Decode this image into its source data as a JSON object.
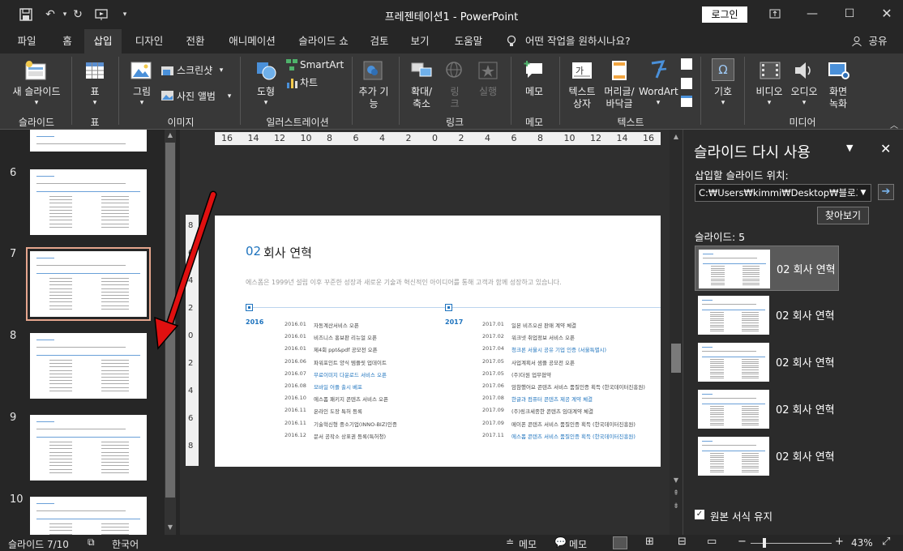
{
  "window": {
    "title": "프레젠테이션1 - PowerPoint",
    "login_label": "로그인",
    "qat_icons": [
      "save-icon",
      "undo-icon",
      "redo-icon",
      "present-icon",
      "customize-icon"
    ]
  },
  "tabs": [
    "파일",
    "홈",
    "삽입",
    "디자인",
    "전환",
    "애니메이션",
    "슬라이드 쇼",
    "검토",
    "보기",
    "도움말"
  ],
  "tell_me": "어떤 작업을 원하시나요?",
  "share": "공유",
  "ribbon": {
    "groups": {
      "slides": "슬라이드",
      "tables": "표",
      "images": "이미지",
      "illustrations": "일러스트레이션",
      "links": "링크",
      "comments": "메모",
      "text": "텍스트",
      "media": "미디어"
    },
    "buttons": {
      "new_slide": "새 슬라이드",
      "table": "표",
      "picture": "그림",
      "screenshot": "스크린샷",
      "photo_album": "사진 앨범",
      "shapes": "도형",
      "smartart": "SmartArt",
      "chart": "차트",
      "addins_1": "추가 기",
      "addins_2": "능",
      "link_1": "확대/",
      "link_2": "축소",
      "hyperlink_1": "링",
      "hyperlink_2": "크",
      "action": "실행",
      "comment": "메모",
      "textbox_1": "텍스트",
      "textbox_2": "상자",
      "header_1": "머리글/",
      "header_2": "바닥글",
      "wordart": "WordArt",
      "symbols": "기호",
      "video": "비디오",
      "audio": "오디오",
      "screenrec_1": "화면",
      "screenrec_2": "녹화"
    }
  },
  "left_pane": {
    "numbers": [
      "6",
      "7",
      "8",
      "9",
      "10"
    ],
    "selected": "7"
  },
  "ruler": {
    "h_ticks": [
      "16",
      "14",
      "12",
      "10",
      "8",
      "6",
      "4",
      "2",
      "0",
      "2",
      "4",
      "6",
      "8",
      "10",
      "12",
      "14",
      "16"
    ],
    "v_ticks": [
      "8",
      "6",
      "4",
      "2",
      "0",
      "2",
      "4",
      "6",
      "8"
    ]
  },
  "slide": {
    "num": "02",
    "title": "회사 연혁",
    "subtitle": "에스폼은 1999년 설립 이후 꾸준한 성장과 새로운 기술과 혁신적인 아이디어를 통해 고객과 함께 성장하고 있습니다.",
    "year_left": "2016",
    "year_right": "2017",
    "left_items": [
      {
        "date": "2016.01",
        "text": "자동계산서비스 오픈",
        "hl": false
      },
      {
        "date": "2016.01",
        "text": "비즈니스 홍보판 리뉴얼 오픈",
        "hl": false
      },
      {
        "date": "2016.01",
        "text": "제4회 ppt&pdf 공모전 오픈",
        "hl": false
      },
      {
        "date": "2016.06",
        "text": "파워포인트 양식 템플릿 업데이트",
        "hl": false
      },
      {
        "date": "2016.07",
        "text": "무료이미지 다운로드 서비스 오픈",
        "hl": true
      },
      {
        "date": "2016.08",
        "text": "모바일 어플 출시 베포",
        "hl": true
      },
      {
        "date": "2016.10",
        "text": "에스폼 패키지 콘텐츠 서비스 오픈",
        "hl": false
      },
      {
        "date": "2016.11",
        "text": "온라인 도장 특허 등록",
        "hl": false
      },
      {
        "date": "2016.11",
        "text": "기술혁신형 중소기업(INNO-BIZ)인증",
        "hl": false
      },
      {
        "date": "2016.12",
        "text": "문서 공작소 상표권 등록(특허청)",
        "hl": false
      }
    ],
    "right_items": [
      {
        "date": "2017.01",
        "text": "일본 비즈오션 판매 계약 체결",
        "hl": false
      },
      {
        "date": "2017.02",
        "text": "워크넷 취업정보 서비스 오픈",
        "hl": false
      },
      {
        "date": "2017.04",
        "text": "청크론 서울시 공유 기업 인증 (서울특별시)",
        "hl": true
      },
      {
        "date": "2017.05",
        "text": "사업계획서 샘플 공모전 오픈",
        "hl": false
      },
      {
        "date": "2017.05",
        "text": "(주)더원 업무협약",
        "hl": false
      },
      {
        "date": "2017.06",
        "text": "암참했어요 콘텐츠 서비스 품질인증 획득 (한국데이터진흥원)",
        "hl": false
      },
      {
        "date": "2017.08",
        "text": "한글과 컴퓨터 콘텐츠 제공 계약 체결",
        "hl": true
      },
      {
        "date": "2017.09",
        "text": "(주)링크세종한 콘텐츠 임대계약 체결",
        "hl": false
      },
      {
        "date": "2017.09",
        "text": "메이폰 콘텐츠 서비스 품질인증 획득 (한국데이터진흥원)",
        "hl": false
      },
      {
        "date": "2017.11",
        "text": "에스폼 콘텐츠 서비스 품질인증 획득 (한국데이터진흥원)",
        "hl": true
      }
    ]
  },
  "reuse_pane": {
    "title": "슬라이드 다시 사용",
    "insert_label": "삽입할 슬라이드 위치:",
    "path": "C:₩Users₩kimmi₩Desktop₩블로그",
    "browse": "찾아보기",
    "slides_count": "슬라이드: 5",
    "thumb_label": "02 회사 연혁",
    "keep_format": "원본 서식 유지"
  },
  "status": {
    "slide_info": "슬라이드 7/10",
    "language": "한국어",
    "notes": "메모",
    "comments": "메모",
    "zoom": "43%"
  },
  "colors": {
    "accent_blue": "#1e73be",
    "selection": "#e5a58d",
    "arrow": "#e01010"
  }
}
